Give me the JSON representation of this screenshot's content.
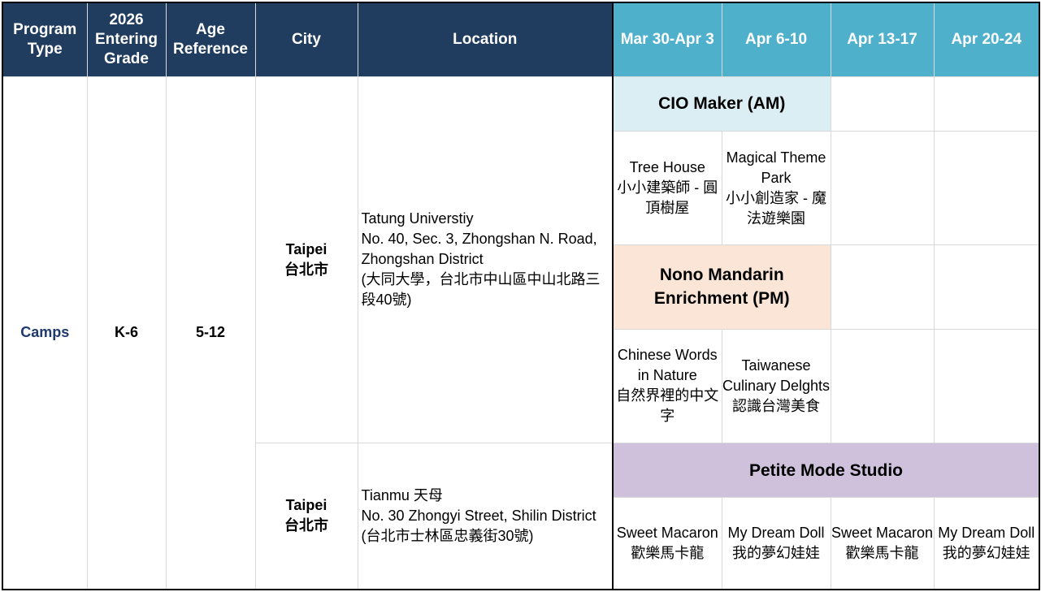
{
  "header": {
    "program_type": [
      "Program",
      "Type"
    ],
    "entering_grade": [
      "2026",
      "Entering",
      "Grade"
    ],
    "age_reference": [
      "Age",
      "Reference"
    ],
    "city": "City",
    "location": "Location",
    "weeks": [
      "Mar 30-Apr 3",
      "Apr 6-10",
      "Apr 13-17",
      "Apr 20-24"
    ]
  },
  "row": {
    "program_type": "Camps",
    "grade": "K-6",
    "age": "5-12"
  },
  "site1": {
    "city": [
      "Taipei",
      "台北市"
    ],
    "location": [
      "Tatung Universtiy",
      "No. 40, Sec. 3, Zhongshan N. Road, Zhongshan District",
      "(大同大學，台北市中山區中山北路三段40號)"
    ],
    "program_am": "CIO Maker (AM)",
    "am_courses": [
      [
        "Tree House",
        "小小建築師 - 圓頂樹屋"
      ],
      [
        "Magical Theme Park",
        "小小創造家 - 魔法遊樂園"
      ]
    ],
    "program_pm": [
      "Nono Mandarin",
      "Enrichment (PM)"
    ],
    "pm_courses": [
      [
        "Chinese Words in Nature",
        "自然界裡的中文字"
      ],
      [
        "Taiwanese Culinary Delghts",
        "認識台灣美食"
      ]
    ]
  },
  "site2": {
    "city": [
      "Taipei",
      "台北市"
    ],
    "location": [
      "Tianmu 天母",
      "No. 30 Zhongyi Street, Shilin District",
      "(台北市士林區忠義街30號)"
    ],
    "program": "Petite Mode Studio",
    "courses": [
      [
        "Sweet Macaron",
        "歡樂馬卡龍"
      ],
      [
        "My Dream Doll",
        "我的夢幻娃娃"
      ],
      [
        "Sweet Macaron",
        "歡樂馬卡龍"
      ],
      [
        "My Dream Doll",
        "我的夢幻娃娃"
      ]
    ]
  },
  "colors": {
    "header_dark": "#203c5e",
    "header_light": "#4fb0cb",
    "cio_bg": "#dbeef3",
    "nono_bg": "#fbe5d6",
    "petite_bg": "#cfc1dc",
    "camps_text": "#1f3a6e"
  }
}
